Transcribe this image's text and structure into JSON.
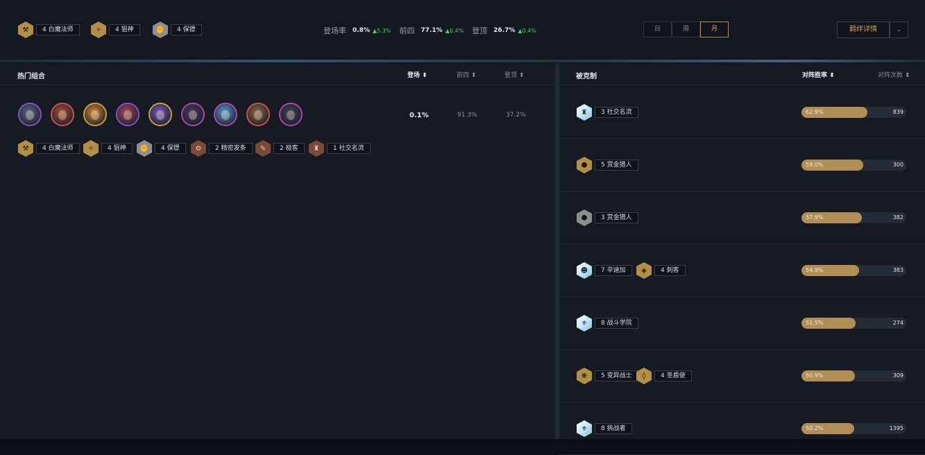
{
  "top_traits": [
    {
      "label": "4 白魔法师",
      "icon": "wand-icon",
      "tier": "gold",
      "glyph": "⚒"
    },
    {
      "label": "4 狙神",
      "icon": "crosshair-icon",
      "tier": "gold",
      "glyph": "✧"
    },
    {
      "label": "4 保镖",
      "icon": "fist-icon",
      "tier": "silver",
      "glyph": "✊"
    }
  ],
  "stats": [
    {
      "label": "登场率",
      "value": "0.8%",
      "delta": "▲5.3%"
    },
    {
      "label": "前四",
      "value": "77.1%",
      "delta": "▲0.4%"
    },
    {
      "label": "登顶",
      "value": "26.7%",
      "delta": "▲0.4%"
    }
  ],
  "period_tabs": [
    {
      "label": "日",
      "active": false
    },
    {
      "label": "周",
      "active": false
    },
    {
      "label": "月",
      "active": true
    }
  ],
  "detail_button": "羁绊详情",
  "left_panel": {
    "title": "热门组合",
    "columns": [
      "登场",
      "前四",
      "登顶"
    ],
    "champions": [
      {
        "icon": "champion-portrait-1",
        "color": "#8a4fd1",
        "fill": "#5b6a8a"
      },
      {
        "icon": "champion-portrait-2",
        "color": "#d14f4f",
        "fill": "#a8523a"
      },
      {
        "icon": "champion-portrait-3",
        "color": "#c9a13a",
        "fill": "#d88b3a"
      },
      {
        "icon": "champion-portrait-4",
        "color": "#8a4fd1",
        "fill": "#a44a5a"
      },
      {
        "icon": "champion-portrait-5",
        "color": "#c9a13a",
        "fill": "#7a5cc2"
      },
      {
        "icon": "champion-portrait-6",
        "color": "#b344b3",
        "fill": "#4a3d5a"
      },
      {
        "icon": "champion-portrait-7",
        "color": "#b344b3",
        "fill": "#5aa0d8"
      },
      {
        "icon": "champion-portrait-8",
        "color": "#d14f4f",
        "fill": "#8a6a45"
      },
      {
        "icon": "champion-portrait-9",
        "color": "#b344b3",
        "fill": "#3d4454"
      }
    ],
    "row_values": {
      "appear": "0.1%",
      "top4": "91.3%",
      "win": "37.2%"
    },
    "traits": [
      {
        "label": "4 白魔法师",
        "icon": "wand-icon",
        "tier": "gold",
        "glyph": "⚒"
      },
      {
        "label": "4 狙神",
        "icon": "crosshair-icon",
        "tier": "gold",
        "glyph": "✧"
      },
      {
        "label": "4 保镖",
        "icon": "fist-icon",
        "tier": "silver",
        "glyph": "✊"
      },
      {
        "label": "2 精密发条",
        "icon": "gear-icon",
        "tier": "bronze",
        "glyph": "⚙"
      },
      {
        "label": "2 极客",
        "icon": "wrench-icon",
        "tier": "bronze",
        "glyph": "✎"
      },
      {
        "label": "1 社交名流",
        "icon": "goblet-icon",
        "tier": "bronze",
        "glyph": "♜"
      }
    ]
  },
  "right_panel": {
    "title": "被克制",
    "columns": [
      "对阵胜率",
      "对阵次数"
    ],
    "rows": [
      {
        "traits": [
          {
            "label": "3 社交名流",
            "icon": "goblet-icon",
            "tier": "chrome",
            "glyph": "♜"
          }
        ],
        "winrate": "62.9%",
        "fraction": 0.629,
        "count": "839"
      },
      {
        "traits": [
          {
            "label": "5 赏金猎人",
            "icon": "bounty-icon",
            "tier": "gold",
            "glyph": "⬢"
          }
        ],
        "winrate": "59.0%",
        "fraction": 0.59,
        "count": "300"
      },
      {
        "traits": [
          {
            "label": "3 赏金猎人",
            "icon": "bounty-icon",
            "tier": "silver",
            "glyph": "⬢"
          }
        ],
        "winrate": "57.9%",
        "fraction": 0.579,
        "count": "382"
      },
      {
        "traits": [
          {
            "label": "7 辛迪加",
            "icon": "syndicate-icon",
            "tier": "chrome",
            "glyph": "☻"
          },
          {
            "label": "4 刺客",
            "icon": "assassin-icon",
            "tier": "gold",
            "glyph": "◈"
          }
        ],
        "winrate": "54.9%",
        "fraction": 0.549,
        "count": "383"
      },
      {
        "traits": [
          {
            "label": "8 战斗学院",
            "icon": "academy-icon",
            "tier": "chrome",
            "glyph": "⚜"
          }
        ],
        "winrate": "51.5%",
        "fraction": 0.515,
        "count": "274"
      },
      {
        "traits": [
          {
            "label": "5 变异战士",
            "icon": "mutant-icon",
            "tier": "gold",
            "glyph": "❋"
          },
          {
            "label": "4 圣盾使",
            "icon": "shield-icon",
            "tier": "gold",
            "glyph": "◊"
          }
        ],
        "winrate": "50.9%",
        "fraction": 0.509,
        "count": "309"
      },
      {
        "traits": [
          {
            "label": "8 挑战者",
            "icon": "challenger-icon",
            "tier": "chrome",
            "glyph": "⚜"
          }
        ],
        "winrate": "50.2%",
        "fraction": 0.502,
        "count": "1395"
      }
    ]
  }
}
